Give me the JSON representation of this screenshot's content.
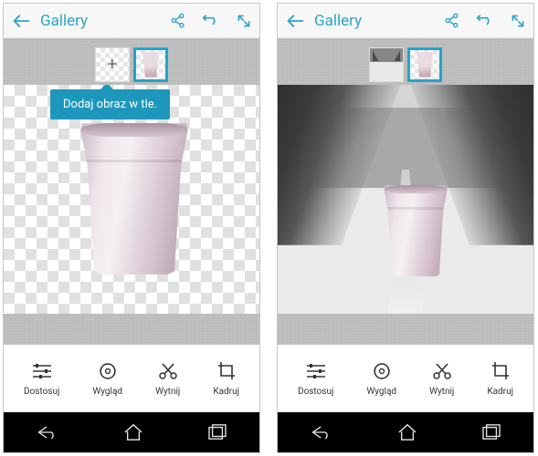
{
  "screens": [
    {
      "header": {
        "title": "Gallery"
      },
      "tooltip": "Dodaj obraz w tle.",
      "thumbs": [
        {
          "kind": "add",
          "selected": false
        },
        {
          "kind": "cup",
          "selected": true
        }
      ],
      "tools": [
        {
          "label": "Dostosuj"
        },
        {
          "label": "Wygląd"
        },
        {
          "label": "Wytnij"
        },
        {
          "label": "Kadruj"
        }
      ]
    },
    {
      "header": {
        "title": "Gallery"
      },
      "thumbs": [
        {
          "kind": "snow",
          "selected": false
        },
        {
          "kind": "cup",
          "selected": true
        }
      ],
      "tools": [
        {
          "label": "Dostosuj"
        },
        {
          "label": "Wygląd"
        },
        {
          "label": "Wytnij"
        },
        {
          "label": "Kadruj"
        }
      ]
    }
  ],
  "icons": {
    "back": "back-arrow-icon",
    "share": "share-icon",
    "undo": "undo-icon",
    "expand": "expand-icon",
    "adjust": "sliders-icon",
    "look": "aperture-icon",
    "cut": "scissors-icon",
    "crop": "crop-icon",
    "navBack": "nav-back-icon",
    "navHome": "nav-home-icon",
    "navRecent": "nav-recent-icon"
  }
}
